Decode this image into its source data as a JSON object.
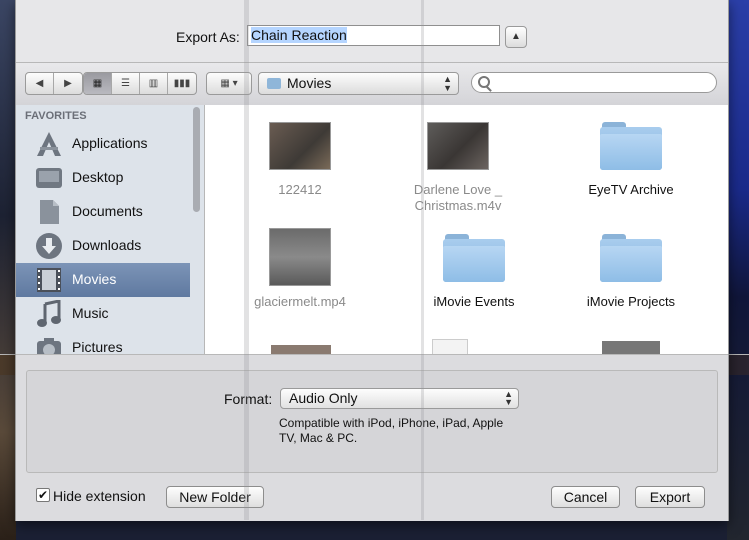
{
  "export": {
    "label": "Export As:",
    "filename": "Chain Reaction"
  },
  "toolbar": {
    "location": "Movies",
    "search_placeholder": ""
  },
  "sidebar": {
    "heading": "FAVORITES",
    "items": [
      {
        "label": "Applications",
        "icon": "applications-icon"
      },
      {
        "label": "Desktop",
        "icon": "desktop-icon"
      },
      {
        "label": "Documents",
        "icon": "documents-icon"
      },
      {
        "label": "Downloads",
        "icon": "downloads-icon"
      },
      {
        "label": "Movies",
        "icon": "movies-icon",
        "selected": true
      },
      {
        "label": "Music",
        "icon": "music-icon"
      },
      {
        "label": "Pictures",
        "icon": "pictures-icon"
      }
    ]
  },
  "files": [
    {
      "name": "122412",
      "kind": "video",
      "dimmed": true
    },
    {
      "name_line1": "Darlene Love _",
      "name_line2": "Christmas.m4v",
      "kind": "video",
      "dimmed": true
    },
    {
      "name": "EyeTV Archive",
      "kind": "folder",
      "dimmed": false
    },
    {
      "name": "glaciermelt.mp4",
      "kind": "video",
      "dimmed": true
    },
    {
      "name": "iMovie Events",
      "kind": "folder",
      "dimmed": false
    },
    {
      "name": "iMovie Projects",
      "kind": "folder",
      "dimmed": false
    }
  ],
  "options": {
    "format_label": "Format:",
    "format_value": "Audio Only",
    "format_note": "Compatible with iPod, iPhone, iPad, Apple TV, Mac & PC."
  },
  "footer": {
    "hide_extension_label": "Hide extension",
    "hide_extension_checked": true,
    "new_folder": "New Folder",
    "cancel": "Cancel",
    "export": "Export"
  },
  "colors": {
    "selection": "#6a84ab",
    "folder": "#8ebde6",
    "sheet": "#e7e7e9"
  }
}
